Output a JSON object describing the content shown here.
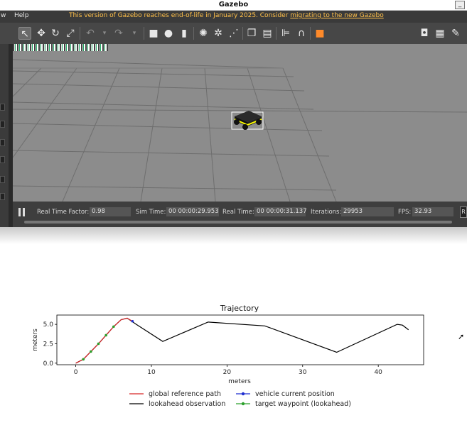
{
  "window": {
    "title": "Gazebo",
    "minimize_glyph": "_"
  },
  "menu": {
    "items": [
      "w",
      "Help"
    ],
    "eol_message": "This version of Gazebo reaches end-of-life in January 2025. Consider ",
    "eol_link": "migrating to the new Gazebo"
  },
  "toolbar": {
    "icons": [
      "select-icon",
      "translate-icon",
      "rotate-icon",
      "scale-icon",
      "undo-icon",
      "undo-dropdown-icon",
      "redo-icon",
      "redo-dropdown-icon",
      "box-icon",
      "sphere-icon",
      "cylinder-icon",
      "point-light-icon",
      "spot-light-icon",
      "directional-light-icon",
      "copy-icon",
      "paste-icon",
      "align-icon",
      "snap-icon",
      "color-icon",
      "screenshot-icon",
      "log-icon",
      "plot-icon"
    ]
  },
  "status_bar": {
    "real_time_factor_label": "Real Time Factor:",
    "real_time_factor": "0.98",
    "sim_time_label": "Sim Time:",
    "sim_time": "00 00:00:29.953",
    "real_time_label": "Real Time:",
    "real_time": "00 00:00:31.137",
    "iterations_label": "Iterations:",
    "iterations": "29953",
    "fps_label": "FPS:",
    "fps": "32.93",
    "reset_label": "R"
  },
  "colors": {
    "global_path": "#d62728",
    "lookahead": "#000000",
    "vehicle": "#1f2fd0",
    "waypoint": "#2ca02c",
    "robot_highlight": "#ffff00"
  },
  "chart_data": {
    "type": "line",
    "title": "Trajectory",
    "xlabel": "meters",
    "ylabel": "meters",
    "xlim": [
      -2.5,
      46
    ],
    "ylim": [
      -0.2,
      6.2
    ],
    "xticks": [
      0,
      10,
      20,
      30,
      40
    ],
    "yticks": [
      "0.0",
      "2.5",
      "5.0"
    ],
    "ytick_values": [
      0,
      2.5,
      5.0
    ],
    "grid": false,
    "legend_position": "bottom",
    "series": [
      {
        "name": "global reference path",
        "style": "line",
        "x": [
          0,
          1,
          2,
          3,
          4,
          5,
          6,
          6.8,
          7.5
        ],
        "y": [
          0.0,
          0.5,
          1.5,
          2.5,
          3.6,
          4.7,
          5.6,
          5.8,
          5.4
        ]
      },
      {
        "name": "lookahead observation",
        "style": "line",
        "x": [
          0,
          1,
          2,
          3,
          4,
          5,
          6,
          6.8,
          8,
          11.5,
          17.5,
          25,
          34.5,
          42.5,
          43.2,
          44
        ],
        "y": [
          0.0,
          0.5,
          1.5,
          2.5,
          3.6,
          4.7,
          5.6,
          5.8,
          5.0,
          2.8,
          5.3,
          4.8,
          1.4,
          5.0,
          4.9,
          4.3
        ]
      },
      {
        "name": "vehicle current position",
        "style": "marker",
        "x": [
          7.5
        ],
        "y": [
          5.4
        ]
      },
      {
        "name": "target waypoint (lookahead)",
        "style": "marker",
        "x": [
          1,
          2,
          3,
          4,
          5
        ],
        "y": [
          0.5,
          1.5,
          2.5,
          3.6,
          4.7
        ]
      }
    ]
  }
}
